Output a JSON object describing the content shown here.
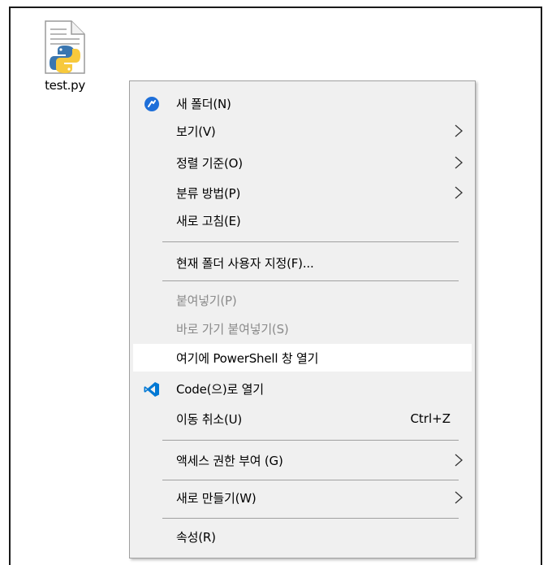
{
  "desktop": {
    "file": {
      "name": "test.py",
      "icon": "python-file-icon"
    }
  },
  "menu": {
    "items": [
      {
        "id": "new-folder",
        "label": "새 폴더(N)",
        "icon": "new-folder-icon"
      },
      {
        "id": "view",
        "label": "보기(V)",
        "submenu": true
      },
      {
        "id": "sort-by",
        "label": "정렬 기준(O)",
        "submenu": true
      },
      {
        "id": "group-by",
        "label": "분류 방법(P)",
        "submenu": true
      },
      {
        "id": "refresh",
        "label": "새로 고침(E)"
      },
      {
        "id": "customize-folder",
        "label": "현재 폴더 사용자 지정(F)..."
      },
      {
        "id": "paste",
        "label": "붙여넣기(P)",
        "disabled": true
      },
      {
        "id": "paste-shortcut",
        "label": "바로 가기 붙여넣기(S)",
        "disabled": true
      },
      {
        "id": "open-powershell",
        "label": "여기에 PowerShell 창 열기",
        "highlighted": true
      },
      {
        "id": "open-with-code",
        "label": "Code(으)로 열기",
        "icon": "vscode-icon"
      },
      {
        "id": "undo-move",
        "label": "이동 취소(U)",
        "shortcut": "Ctrl+Z"
      },
      {
        "id": "give-access",
        "label": "액세스 권한 부여 (G)",
        "submenu": true
      },
      {
        "id": "new",
        "label": "새로 만들기(W)",
        "submenu": true
      },
      {
        "id": "properties",
        "label": "속성(R)"
      }
    ]
  },
  "colors": {
    "menu_bg": "#f0f0f0",
    "highlight_bg": "#ffffff",
    "disabled_text": "#8a8a8a",
    "vscode_blue": "#0078d4"
  }
}
